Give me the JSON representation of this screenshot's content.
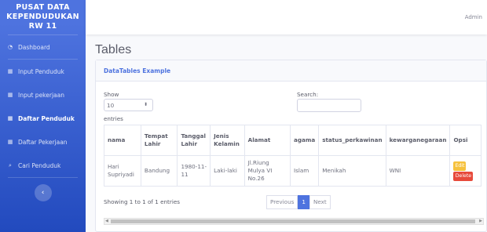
{
  "sidebar": {
    "brand": [
      "PUSAT DATA",
      "KEPENDUDUKAN",
      "RW 11"
    ],
    "items": [
      {
        "label": "Dashboard",
        "icon": "gauge-icon"
      },
      {
        "label": "Input Penduduk",
        "icon": "table-icon"
      },
      {
        "label": "Input pekerjaan",
        "icon": "table-icon"
      },
      {
        "label": "Daftar Penduduk",
        "icon": "table-icon"
      },
      {
        "label": "Daftar Pekerjaan",
        "icon": "table-icon"
      },
      {
        "label": "Cari Penduduk",
        "icon": "search-icon"
      }
    ],
    "toggle": "‹"
  },
  "topbar": {
    "user": "Admin"
  },
  "page": {
    "title": "Tables"
  },
  "card": {
    "title": "DataTables Example"
  },
  "table_controls": {
    "show_label": "Show",
    "length_value": "10",
    "entries_label": "entries",
    "search_label": "Search:"
  },
  "table": {
    "headers": [
      "nama",
      "Tempat Lahir",
      "Tanggal Lahir",
      "Jenis Kelamin",
      "Alamat",
      "agama",
      "status_perkawinan",
      "kewarganegaraan",
      "Opsi"
    ],
    "rows": [
      {
        "nama": "Hari Supriyadi",
        "tempat": "Bandung",
        "tanggal": "1980-11-11",
        "jk": "Laki-laki",
        "alamat": "Jl.Riung Mulya VI No.26",
        "agama": "Islam",
        "status": "Menikah",
        "warga": "WNI",
        "edit": "Edit",
        "delete": "Delete"
      }
    ]
  },
  "footer": {
    "info": "Showing 1 to 1 of 1 entries",
    "previous": "Previous",
    "page": "1",
    "next": "Next"
  },
  "colors": {
    "primary": "#4e73df",
    "warning": "#f6c23e",
    "danger": "#e74a3b"
  }
}
